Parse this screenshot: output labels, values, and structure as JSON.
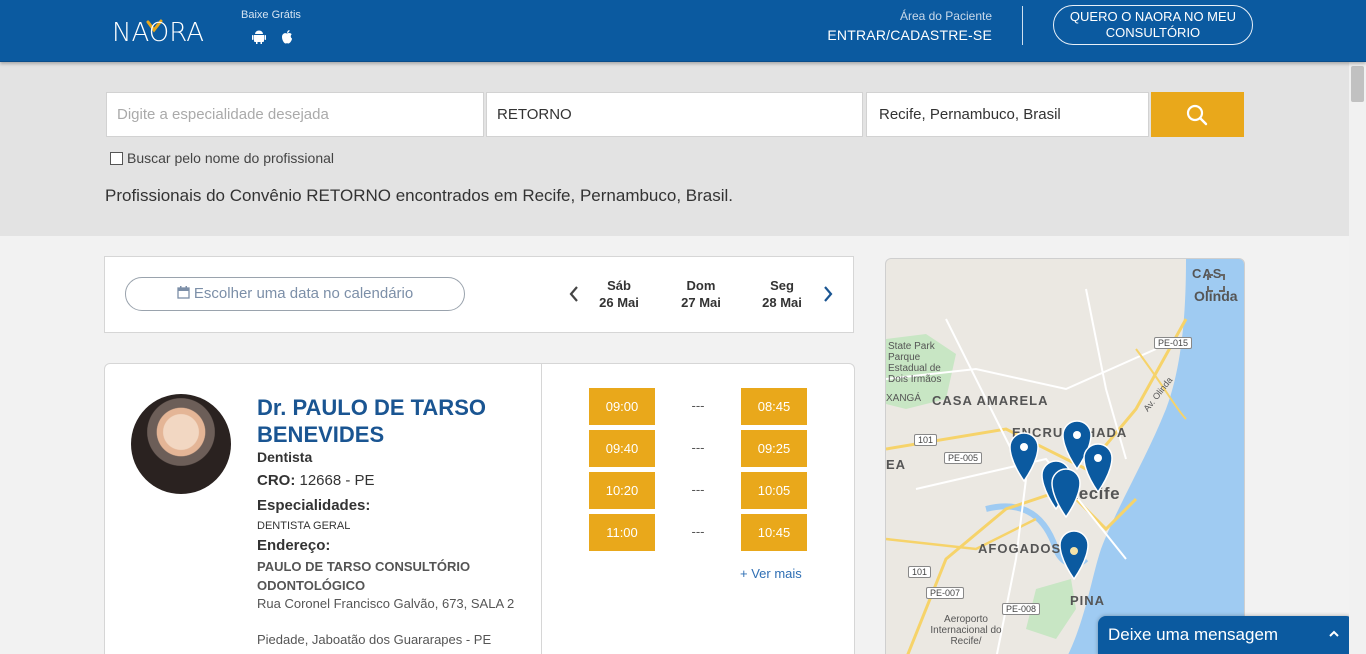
{
  "header": {
    "logo_text": "NAORA",
    "download_label": "Baixe Grátis",
    "patient_area_label": "Área do Paciente",
    "login_label": "ENTRAR/CADASTRE-SE",
    "cta_label": "QUERO O NAORA NO MEU CONSULTÓRIO"
  },
  "search": {
    "specialty_placeholder": "Digite a especialidade desejada",
    "insurance_value": "RETORNO",
    "location_value": "Recife, Pernambuco, Brasil",
    "by_name_label": "Buscar pelo nome do profissional",
    "result_text": "Profissionais do Convênio RETORNO encontrados em Recife, Pernambuco, Brasil."
  },
  "datebar": {
    "calendar_label": "Escolher uma data no calendário",
    "days": [
      {
        "weekday": "Sáb",
        "date": "26 Mai"
      },
      {
        "weekday": "Dom",
        "date": "27 Mai"
      },
      {
        "weekday": "Seg",
        "date": "28 Mai"
      }
    ]
  },
  "professional": {
    "name": "Dr. PAULO DE TARSO BENEVIDES",
    "profession": "Dentista",
    "cro_label": "CRO:",
    "cro_value": "12668 - PE",
    "specialties_label": "Especialidades:",
    "specialties": "DENTISTA GERAL",
    "address_label": "Endereço:",
    "clinic": "PAULO DE TARSO CONSULTÓRIO ODONTOLÓGICO",
    "street": "Rua Coronel Francisco Galvão, 673, SALA 2",
    "city": "Piedade, Jaboatão dos Guararapes - PE"
  },
  "slots": {
    "sat": [
      "09:00",
      "09:40",
      "10:20",
      "11:00"
    ],
    "sun": [
      "---",
      "---",
      "---",
      "---"
    ],
    "mon": [
      "08:45",
      "09:25",
      "10:05",
      "10:45"
    ],
    "more_label": "+ Ver mais"
  },
  "map": {
    "labels": [
      "CASA AMARELA",
      "ENCRUZILHADA",
      "AFOGADOS",
      "PINA",
      "Recife",
      "Olinda"
    ],
    "park_label": "State Park Parque Estadual de Dois Irmãos",
    "airport_label": "Aeroporto Internacional do Recife/",
    "road_labels": [
      "PE-015",
      "PE-005",
      "101",
      "101",
      "PE-007",
      "PE-008"
    ],
    "av_label": "Av. Olinda",
    "marker_color": "#0b5aa0"
  },
  "chat": {
    "label": "Deixe uma mensagem"
  },
  "colors": {
    "primary": "#0b5aa0",
    "accent": "#e9a81b"
  }
}
